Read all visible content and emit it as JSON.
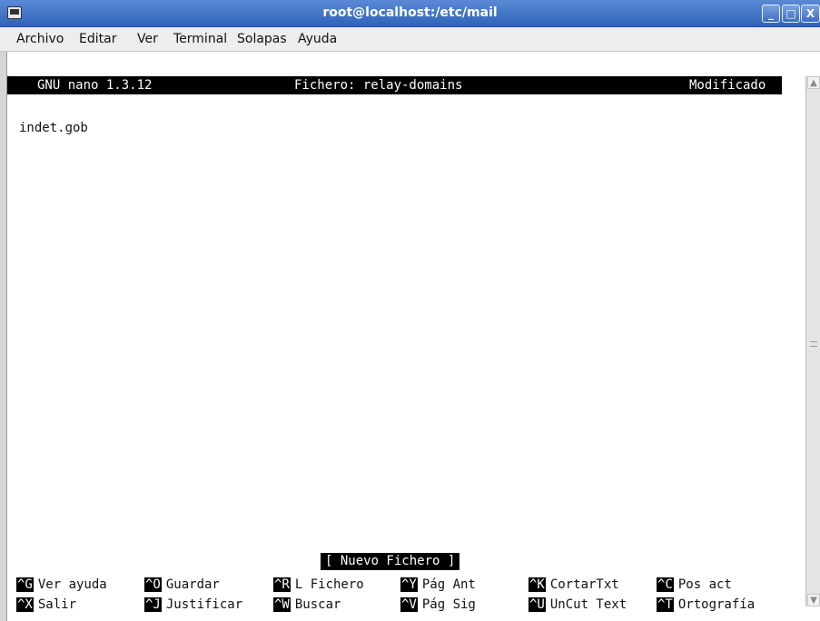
{
  "window": {
    "title": "root@localhost:/etc/mail",
    "buttons": {
      "minimize": "_",
      "maximize": "□",
      "close": "X"
    }
  },
  "menubar": {
    "items": [
      "Archivo",
      "Editar",
      "Ver",
      "Terminal",
      "Solapas",
      "Ayuda"
    ]
  },
  "nano": {
    "version": "GNU nano 1.3.12",
    "file_label": "Fichero: relay-domains",
    "state": "Modificado",
    "content": [
      "indet.gob"
    ],
    "message": "[ Nuevo Fichero ]",
    "shortcuts_row1": [
      {
        "key": "^G",
        "label": "Ver ayuda"
      },
      {
        "key": "^O",
        "label": "Guardar"
      },
      {
        "key": "^R",
        "label": "L Fichero"
      },
      {
        "key": "^Y",
        "label": "Pág Ant"
      },
      {
        "key": "^K",
        "label": "CortarTxt"
      },
      {
        "key": "^C",
        "label": "Pos act"
      }
    ],
    "shortcuts_row2": [
      {
        "key": "^X",
        "label": "Salir"
      },
      {
        "key": "^J",
        "label": "Justificar"
      },
      {
        "key": "^W",
        "label": "Buscar"
      },
      {
        "key": "^V",
        "label": "Pág Sig"
      },
      {
        "key": "^U",
        "label": "UnCut Text"
      },
      {
        "key": "^T",
        "label": "Ortografía"
      }
    ]
  }
}
